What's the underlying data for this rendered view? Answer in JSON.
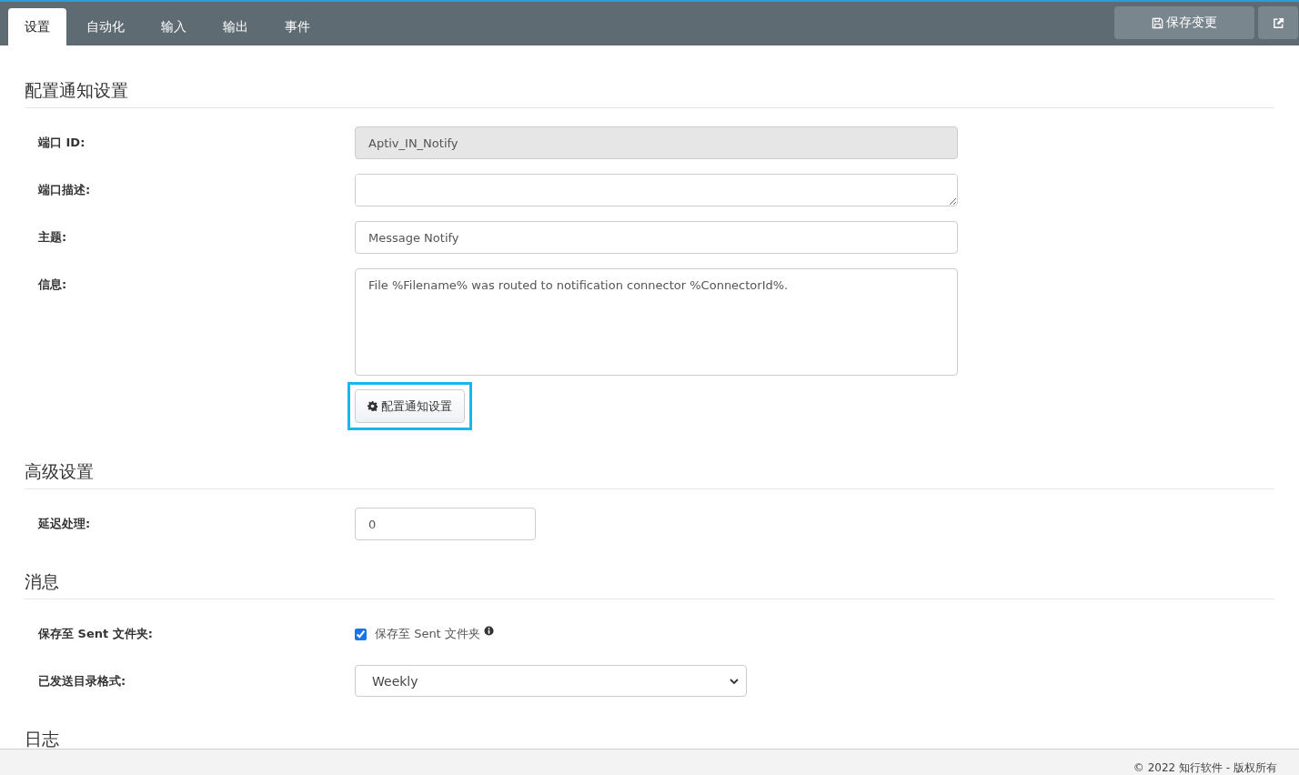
{
  "tabs": [
    {
      "label": "设置",
      "selected": true
    },
    {
      "label": "自动化",
      "selected": false
    },
    {
      "label": "输入",
      "selected": false
    },
    {
      "label": "输出",
      "selected": false
    },
    {
      "label": "事件",
      "selected": false
    }
  ],
  "toolbar": {
    "save_label": "保存变更"
  },
  "sections": [
    {
      "title": "配置通知设置",
      "fields": [
        {
          "label": "端口 ID:",
          "kind": "text",
          "value": "Aptiv_IN_Notify",
          "disabled": true
        },
        {
          "label": "端口描述:",
          "kind": "textarea"
        },
        {
          "label": "主题:",
          "kind": "text",
          "value": "Message Notify",
          "disabled": false
        },
        {
          "label": "信息:",
          "kind": "message",
          "value": "File %Filename% was routed to notification connector %ConnectorId%."
        }
      ],
      "button": {
        "label": "配置通知设置",
        "highlighted": true
      }
    },
    {
      "title": "高级设置",
      "fields": [
        {
          "label": "延迟处理:",
          "kind": "number",
          "value": "0"
        }
      ]
    },
    {
      "title": "消息",
      "fields": [
        {
          "label": "保存至 Sent 文件夹:",
          "kind": "checkbox",
          "text": "保存至 Sent 文件夹",
          "checked": true
        },
        {
          "label": "已发送目录格式:",
          "kind": "select",
          "value": "Weekly"
        }
      ]
    },
    {
      "title": "日志"
    }
  ],
  "footer": "© 2022 知行软件 - 版权所有"
}
